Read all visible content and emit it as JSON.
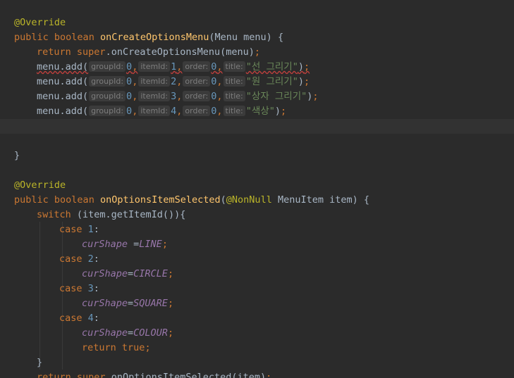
{
  "editor": {
    "lines": [
      {
        "tokens": [
          {
            "t": "@Override",
            "c": "ann"
          }
        ]
      },
      {
        "tokens": [
          {
            "t": "public",
            "c": "kw"
          },
          {
            "t": " ",
            "c": "txt"
          },
          {
            "t": "boolean",
            "c": "kw"
          },
          {
            "t": " ",
            "c": "txt"
          },
          {
            "t": "onCreateOptionsMenu",
            "c": "fn"
          },
          {
            "t": "(Menu menu) {",
            "c": "txt"
          }
        ]
      },
      {
        "tokens": [
          {
            "t": "return",
            "c": "kw"
          },
          {
            "t": " ",
            "c": "txt"
          },
          {
            "t": "super",
            "c": "kw"
          },
          {
            "t": ".onCreateOptionsMenu(menu)",
            "c": "txt"
          },
          {
            "t": ";",
            "c": "kw"
          }
        ]
      },
      {
        "warn": true,
        "tokens": [
          {
            "t": "menu.add(",
            "c": "txt"
          },
          {
            "h": "groupId:"
          },
          {
            "t": "0",
            "c": "num"
          },
          {
            "t": ",",
            "c": "kw"
          },
          {
            "h": "itemId:"
          },
          {
            "t": "1",
            "c": "num"
          },
          {
            "t": ",",
            "c": "kw"
          },
          {
            "h": "order:"
          },
          {
            "t": "0",
            "c": "num"
          },
          {
            "t": ",",
            "c": "kw"
          },
          {
            "h": "title:"
          },
          {
            "t": "\"선 그리기\"",
            "c": "str"
          },
          {
            "t": ")",
            "c": "txt"
          },
          {
            "t": ";",
            "c": "kw"
          }
        ]
      },
      {
        "tokens": [
          {
            "t": "menu.add(",
            "c": "txt"
          },
          {
            "h": "groupId:"
          },
          {
            "t": "0",
            "c": "num"
          },
          {
            "t": ",",
            "c": "kw"
          },
          {
            "h": "itemId:"
          },
          {
            "t": "2",
            "c": "num"
          },
          {
            "t": ",",
            "c": "kw"
          },
          {
            "h": "order:"
          },
          {
            "t": "0",
            "c": "num"
          },
          {
            "t": ",",
            "c": "kw"
          },
          {
            "h": "title:"
          },
          {
            "t": "\"원 그리기\"",
            "c": "str"
          },
          {
            "t": ")",
            "c": "txt"
          },
          {
            "t": ";",
            "c": "kw"
          }
        ]
      },
      {
        "tokens": [
          {
            "t": "menu.add(",
            "c": "txt"
          },
          {
            "h": "groupId:"
          },
          {
            "t": "0",
            "c": "num"
          },
          {
            "t": ",",
            "c": "kw"
          },
          {
            "h": "itemId:"
          },
          {
            "t": "3",
            "c": "num"
          },
          {
            "t": ",",
            "c": "kw"
          },
          {
            "h": "order:"
          },
          {
            "t": "0",
            "c": "num"
          },
          {
            "t": ",",
            "c": "kw"
          },
          {
            "h": "title:"
          },
          {
            "t": "\"상자 그리기\"",
            "c": "str"
          },
          {
            "t": ")",
            "c": "txt"
          },
          {
            "t": ";",
            "c": "kw"
          }
        ]
      },
      {
        "tokens": [
          {
            "t": "menu.add(",
            "c": "txt"
          },
          {
            "h": "groupId:"
          },
          {
            "t": "0",
            "c": "num"
          },
          {
            "t": ",",
            "c": "kw"
          },
          {
            "h": "itemId:"
          },
          {
            "t": "4",
            "c": "num"
          },
          {
            "t": ",",
            "c": "kw"
          },
          {
            "h": "order:"
          },
          {
            "t": "0",
            "c": "num"
          },
          {
            "t": ",",
            "c": "kw"
          },
          {
            "h": "title:"
          },
          {
            "t": "\"색상\"",
            "c": "str"
          },
          {
            "t": ")",
            "c": "txt"
          },
          {
            "t": ";",
            "c": "kw"
          }
        ]
      },
      {
        "current": true,
        "tokens": []
      },
      {
        "tokens": []
      },
      {
        "tokens": [
          {
            "t": "}",
            "c": "txt"
          }
        ]
      },
      {
        "tokens": []
      },
      {
        "tokens": [
          {
            "t": "@Override",
            "c": "ann"
          }
        ]
      },
      {
        "tokens": [
          {
            "t": "public",
            "c": "kw"
          },
          {
            "t": " ",
            "c": "txt"
          },
          {
            "t": "boolean",
            "c": "kw"
          },
          {
            "t": " ",
            "c": "txt"
          },
          {
            "t": "onOptionsItemSelected",
            "c": "fn"
          },
          {
            "t": "(",
            "c": "txt"
          },
          {
            "t": "@NonNull",
            "c": "ann"
          },
          {
            "t": " MenuItem item) {",
            "c": "txt"
          }
        ]
      },
      {
        "tokens": [
          {
            "t": "switch",
            "c": "kw"
          },
          {
            "t": " (item.getItemId()){",
            "c": "txt"
          }
        ]
      },
      {
        "tokens": [
          {
            "t": "case",
            "c": "kw"
          },
          {
            "t": " ",
            "c": "txt"
          },
          {
            "t": "1",
            "c": "num"
          },
          {
            "t": ":",
            "c": "txt"
          }
        ]
      },
      {
        "tokens": [
          {
            "t": "curShape",
            "c": "fld"
          },
          {
            "t": " =",
            "c": "txt"
          },
          {
            "t": "LINE",
            "c": "fld"
          },
          {
            "t": ";",
            "c": "kw"
          }
        ]
      },
      {
        "tokens": [
          {
            "t": "case",
            "c": "kw"
          },
          {
            "t": " ",
            "c": "txt"
          },
          {
            "t": "2",
            "c": "num"
          },
          {
            "t": ":",
            "c": "txt"
          }
        ]
      },
      {
        "tokens": [
          {
            "t": "curShape",
            "c": "fld"
          },
          {
            "t": "=",
            "c": "txt"
          },
          {
            "t": "CIRCLE",
            "c": "fld"
          },
          {
            "t": ";",
            "c": "kw"
          }
        ]
      },
      {
        "tokens": [
          {
            "t": "case",
            "c": "kw"
          },
          {
            "t": " ",
            "c": "txt"
          },
          {
            "t": "3",
            "c": "num"
          },
          {
            "t": ":",
            "c": "txt"
          }
        ]
      },
      {
        "tokens": [
          {
            "t": "curShape",
            "c": "fld"
          },
          {
            "t": "=",
            "c": "txt"
          },
          {
            "t": "SQUARE",
            "c": "fld"
          },
          {
            "t": ";",
            "c": "kw"
          }
        ]
      },
      {
        "tokens": [
          {
            "t": "case",
            "c": "kw"
          },
          {
            "t": " ",
            "c": "txt"
          },
          {
            "t": "4",
            "c": "num"
          },
          {
            "t": ":",
            "c": "txt"
          }
        ]
      },
      {
        "tokens": [
          {
            "t": "curShape",
            "c": "fld"
          },
          {
            "t": "=",
            "c": "txt"
          },
          {
            "t": "COLOUR",
            "c": "fld"
          },
          {
            "t": ";",
            "c": "kw"
          }
        ]
      },
      {
        "tokens": [
          {
            "t": "return",
            "c": "kw"
          },
          {
            "t": " ",
            "c": "txt"
          },
          {
            "t": "true",
            "c": "kw"
          },
          {
            "t": ";",
            "c": "kw"
          }
        ]
      },
      {
        "tokens": [
          {
            "t": "}",
            "c": "txt"
          }
        ]
      },
      {
        "tokens": [
          {
            "t": "return",
            "c": "kw"
          },
          {
            "t": " ",
            "c": "txt"
          },
          {
            "t": "super",
            "c": "kw"
          },
          {
            "t": ".onOptionsItemSelected(item)",
            "c": "txt"
          },
          {
            "t": ";",
            "c": "kw"
          }
        ]
      }
    ]
  },
  "colors": {
    "background": "#2b2b2b",
    "current_line": "#323232",
    "annotation": "#bbb529",
    "keyword": "#cc7832",
    "method_declaration": "#ffc66d",
    "string": "#6a8759",
    "number": "#6897bb",
    "field": "#9876aa",
    "default_text": "#a9b7c6",
    "inlay_hint_bg": "#3b3b3b",
    "warning_underline": "#bc3f3c"
  }
}
